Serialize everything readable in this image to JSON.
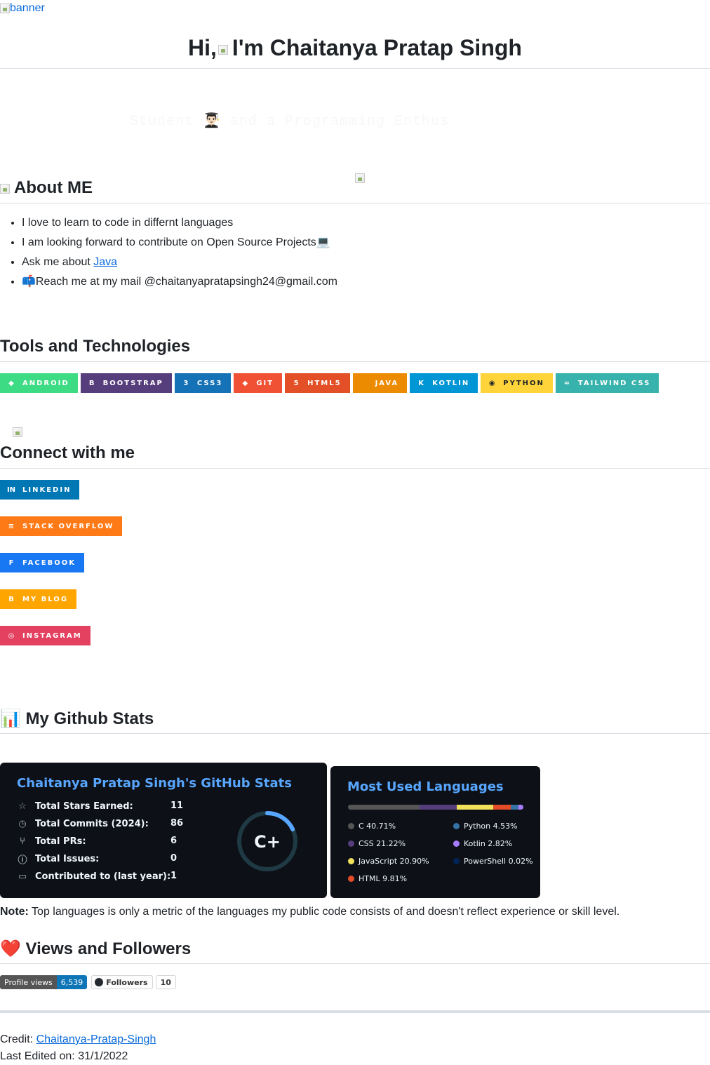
{
  "banner": {
    "alt": "banner"
  },
  "header": {
    "hi": "Hi,",
    "name": "I'm Chaitanya Pratap Singh"
  },
  "typing_text": "Student 👨🏻‍🎓 and a Programming Enthus",
  "about": {
    "heading": "About ME",
    "items": [
      {
        "text": "I love to learn to code in differnt languages"
      },
      {
        "text": "I am looking forward to contribute on Open Source Projects💻"
      },
      {
        "prefix": "Ask me about ",
        "link": "Java"
      },
      {
        "text": "📫Reach me at my mail @chaitanyapratapsingh24@gmail.com"
      }
    ]
  },
  "tools": {
    "heading": "Tools and Technologies",
    "badges": [
      {
        "label": "ANDROID",
        "icon": "android-icon",
        "glyph": "◆",
        "color": "#3ddc84"
      },
      {
        "label": "BOOTSTRAP",
        "icon": "bootstrap-icon",
        "glyph": "B",
        "color": "#563d7c"
      },
      {
        "label": "CSS3",
        "icon": "css3-icon",
        "glyph": "3",
        "color": "#1572b6"
      },
      {
        "label": "GIT",
        "icon": "git-icon",
        "glyph": "◆",
        "color": "#f05033"
      },
      {
        "label": "HTML5",
        "icon": "html5-icon",
        "glyph": "5",
        "color": "#e34f26"
      },
      {
        "label": "JAVA",
        "icon": "java-icon",
        "glyph": "",
        "color": "#ed8b00"
      },
      {
        "label": "KOTLIN",
        "icon": "kotlin-icon",
        "glyph": "K",
        "color": "#0095d5"
      },
      {
        "label": "PYTHON",
        "icon": "python-icon",
        "glyph": "◉",
        "color": "#ffd43b"
      },
      {
        "label": "TAILWIND CSS",
        "icon": "tailwind-icon",
        "glyph": "≈",
        "color": "#38b2ac"
      }
    ]
  },
  "connect": {
    "heading": "Connect with me",
    "badges": [
      {
        "label": "LINKEDIN",
        "icon": "linkedin-icon",
        "glyph": "in",
        "color": "#0077b5"
      },
      {
        "label": "STACK OVERFLOW",
        "icon": "stackoverflow-icon",
        "glyph": "≡",
        "color": "#fe7a16"
      },
      {
        "label": "FACEBOOK",
        "icon": "facebook-icon",
        "glyph": "f",
        "color": "#1877f2"
      },
      {
        "label": "MY BLOG",
        "icon": "blogger-icon",
        "glyph": "B",
        "color": "#ffa500"
      },
      {
        "label": "INSTAGRAM",
        "icon": "instagram-icon",
        "glyph": "◎",
        "color": "#e4405f"
      }
    ]
  },
  "github": {
    "heading": "📊 My Github Stats",
    "stats_card": {
      "title": "Chaitanya Pratap Singh's GitHub Stats",
      "rows": [
        {
          "label": "Total Stars Earned:",
          "value": "11",
          "icon": "star-icon",
          "glyph": "☆"
        },
        {
          "label": "Total Commits (2024):",
          "value": "86",
          "icon": "history-icon",
          "glyph": "◷"
        },
        {
          "label": "Total PRs:",
          "value": "6",
          "icon": "pull-request-icon",
          "glyph": "⑂"
        },
        {
          "label": "Total Issues:",
          "value": "0",
          "icon": "issue-icon",
          "glyph": "ⓘ"
        },
        {
          "label": "Contributed to (last year):",
          "value": "1",
          "icon": "repo-icon",
          "glyph": "▭"
        }
      ],
      "grade": "C+",
      "grade_progress": 0.18
    },
    "langs_card": {
      "title": "Most Used Languages",
      "languages": [
        {
          "name": "C",
          "percent": 40.71,
          "label": "C 40.71%",
          "color": "#555555"
        },
        {
          "name": "CSS",
          "percent": 21.22,
          "label": "CSS 21.22%",
          "color": "#563d7c"
        },
        {
          "name": "JavaScript",
          "percent": 20.9,
          "label": "JavaScript 20.90%",
          "color": "#f1e05a"
        },
        {
          "name": "HTML",
          "percent": 9.81,
          "label": "HTML 9.81%",
          "color": "#e34c26"
        },
        {
          "name": "Python",
          "percent": 4.53,
          "label": "Python 4.53%",
          "color": "#3572A5"
        },
        {
          "name": "Kotlin",
          "percent": 2.82,
          "label": "Kotlin 2.82%",
          "color": "#A97BFF"
        },
        {
          "name": "PowerShell",
          "percent": 0.02,
          "label": "PowerShell 0.02%",
          "color": "#012456"
        }
      ]
    },
    "note_bold": "Note:",
    "note_text": " Top languages is only a metric of the languages my public code consists of and doesn't reflect experience or skill level."
  },
  "views": {
    "heading": "❤️ Views and Followers",
    "profile_views_label": "Profile views",
    "profile_views_value": "6,539",
    "followers_label": "Followers",
    "followers_value": "10"
  },
  "footer": {
    "credit_label": "Credit: ",
    "credit_link": "Chaitanya-Pratap-Singh",
    "edited": "Last Edited on: 31/1/2022"
  }
}
